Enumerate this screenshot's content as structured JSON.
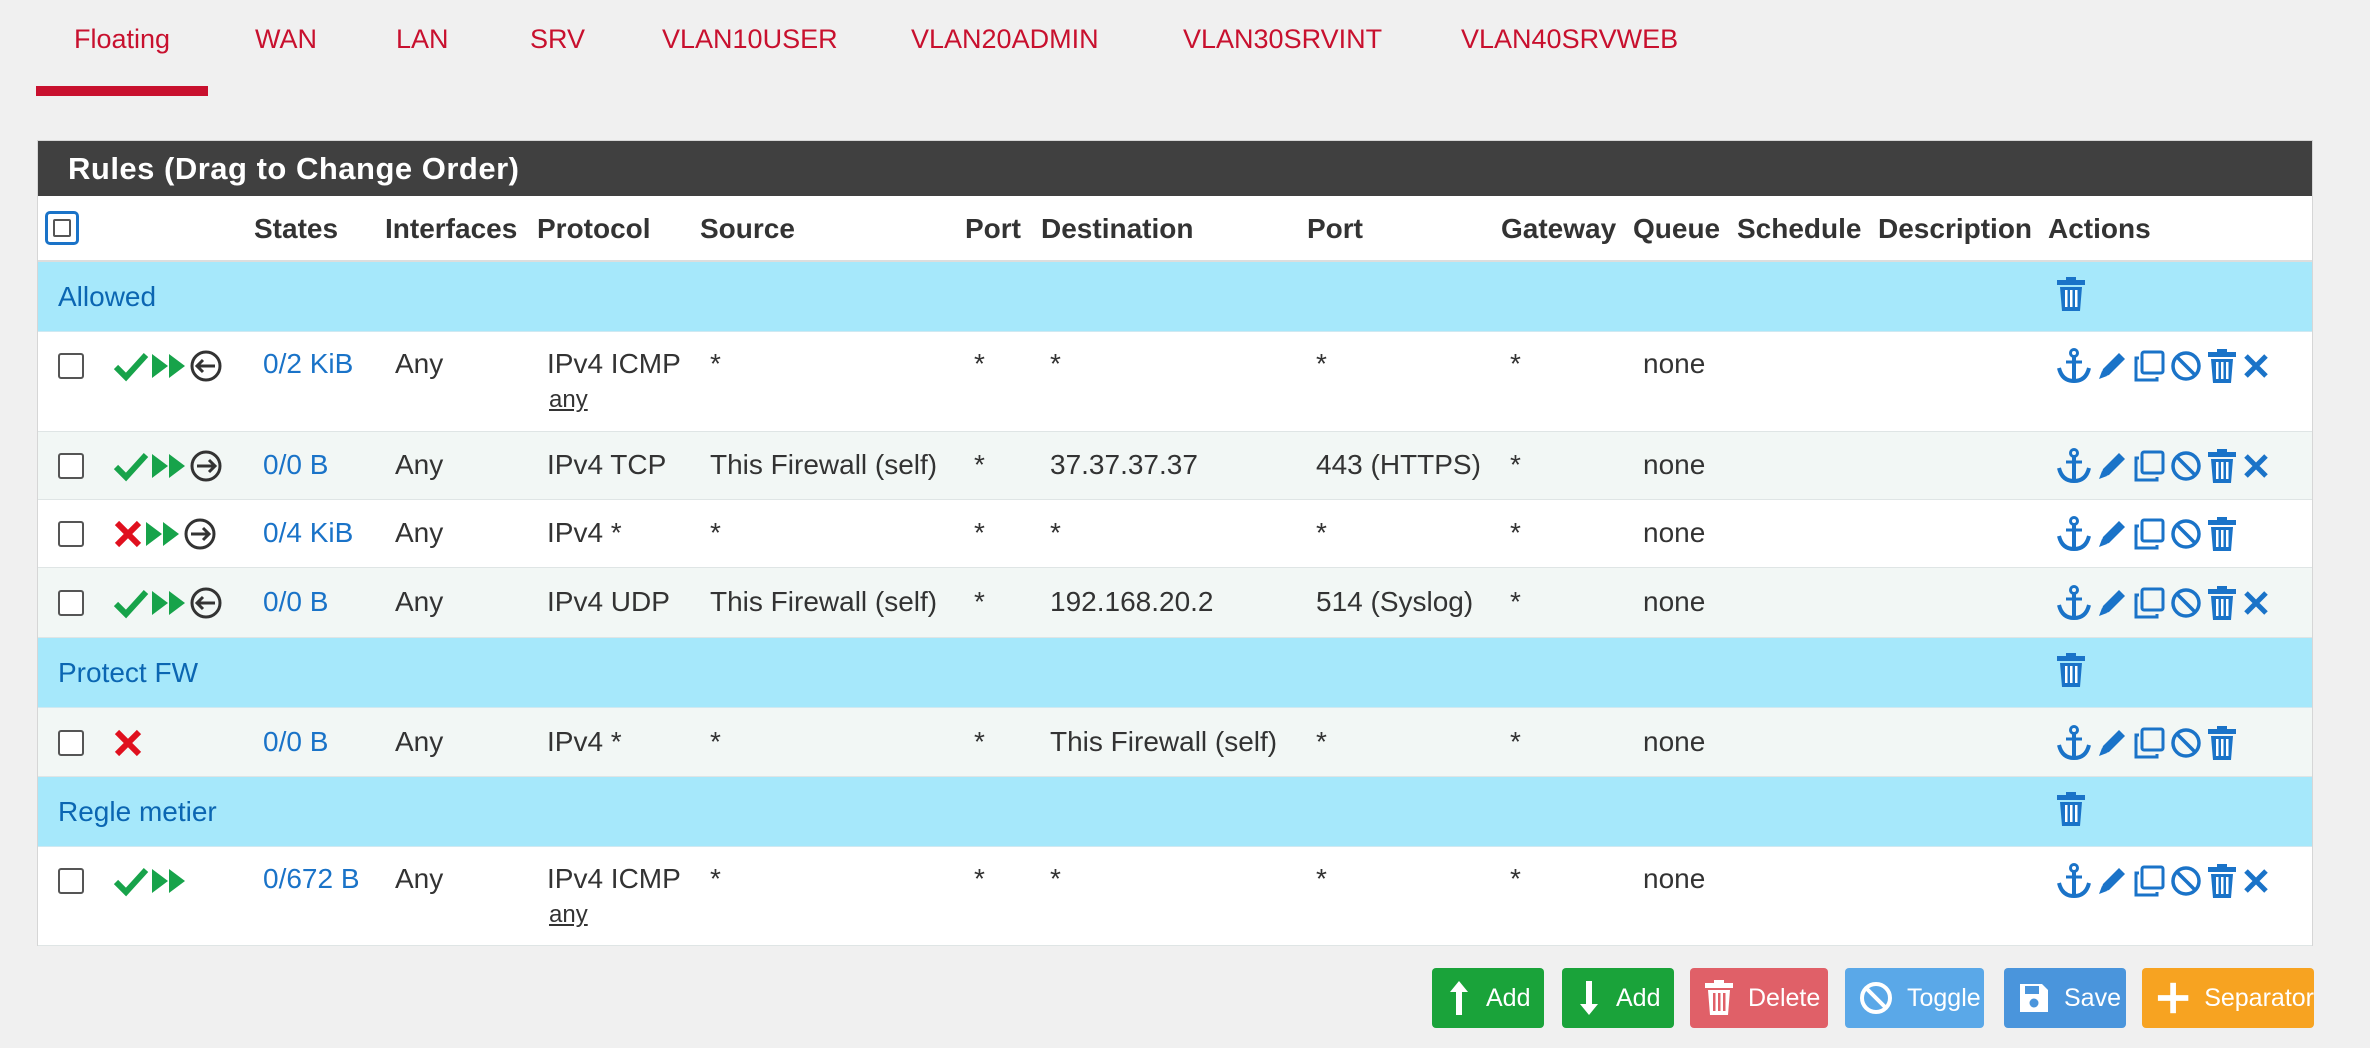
{
  "tabs": [
    {
      "label": "Floating",
      "active": true
    },
    {
      "label": "WAN"
    },
    {
      "label": "LAN"
    },
    {
      "label": "SRV"
    },
    {
      "label": "VLAN10USER"
    },
    {
      "label": "VLAN20ADMIN"
    },
    {
      "label": "VLAN30SRVINT"
    },
    {
      "label": "VLAN40SRVWEB"
    }
  ],
  "panel": {
    "title": "Rules (Drag to Change Order)",
    "columns": {
      "states": "States",
      "interfaces": "Interfaces",
      "protocol": "Protocol",
      "source": "Source",
      "sport": "Port",
      "destination": "Destination",
      "dport": "Port",
      "gateway": "Gateway",
      "queue": "Queue",
      "schedule": "Schedule",
      "description": "Description",
      "actions": "Actions"
    }
  },
  "separators": [
    {
      "label": "Allowed"
    },
    {
      "label": "Protect FW"
    },
    {
      "label": "Regle metier"
    }
  ],
  "rules": [
    {
      "status": "pass",
      "quick": true,
      "direction": "in",
      "states": "0/2 KiB",
      "interfaces": "Any",
      "protocol": "IPv4 ICMP",
      "protocol_sub": "any",
      "source": "*",
      "sport": "*",
      "destination": "*",
      "dport": "*",
      "gateway": "*",
      "queue": "none",
      "has_remove": true
    },
    {
      "status": "pass",
      "quick": true,
      "direction": "out",
      "states": "0/0 B",
      "interfaces": "Any",
      "protocol": "IPv4 TCP",
      "protocol_sub": "",
      "source": "This Firewall (self)",
      "sport": "*",
      "destination": "37.37.37.37",
      "dport": "443 (HTTPS)",
      "gateway": "*",
      "queue": "none",
      "has_remove": true
    },
    {
      "status": "block",
      "quick": true,
      "direction": "out",
      "states": "0/4 KiB",
      "interfaces": "Any",
      "protocol": "IPv4 *",
      "protocol_sub": "",
      "source": "*",
      "sport": "*",
      "destination": "*",
      "dport": "*",
      "gateway": "*",
      "queue": "none",
      "has_remove": false
    },
    {
      "status": "pass",
      "quick": true,
      "direction": "in",
      "states": "0/0 B",
      "interfaces": "Any",
      "protocol": "IPv4 UDP",
      "protocol_sub": "",
      "source": "This Firewall (self)",
      "sport": "*",
      "destination": "192.168.20.2",
      "dport": "514 (Syslog)",
      "gateway": "*",
      "queue": "none",
      "has_remove": true
    },
    {
      "status": "block",
      "quick": false,
      "direction": "",
      "states": "0/0 B",
      "interfaces": "Any",
      "protocol": "IPv4 *",
      "protocol_sub": "",
      "source": "*",
      "sport": "*",
      "destination": "This Firewall (self)",
      "dport": "*",
      "gateway": "*",
      "queue": "none",
      "has_remove": false
    },
    {
      "status": "pass",
      "quick": true,
      "direction": "",
      "states": "0/672 B",
      "interfaces": "Any",
      "protocol": "IPv4 ICMP",
      "protocol_sub": "any",
      "source": "*",
      "sport": "*",
      "destination": "*",
      "dport": "*",
      "gateway": "*",
      "queue": "none",
      "has_remove": true
    }
  ],
  "buttons": {
    "add_top": "Add",
    "add_bottom": "Add",
    "delete": "Delete",
    "toggle": "Toggle",
    "save": "Save",
    "separator": "Separator"
  },
  "colors": {
    "accent_red": "#c8102e",
    "link_blue": "#1a73c8",
    "separator_bg": "#a6e8fb",
    "pass_green": "#17a34a",
    "block_red": "#e0101e",
    "btn_green": "#1aa33a",
    "btn_delete": "#e06068",
    "btn_toggle": "#5aa8e8",
    "btn_save": "#4a95dc",
    "btn_separator": "#f7a321"
  }
}
